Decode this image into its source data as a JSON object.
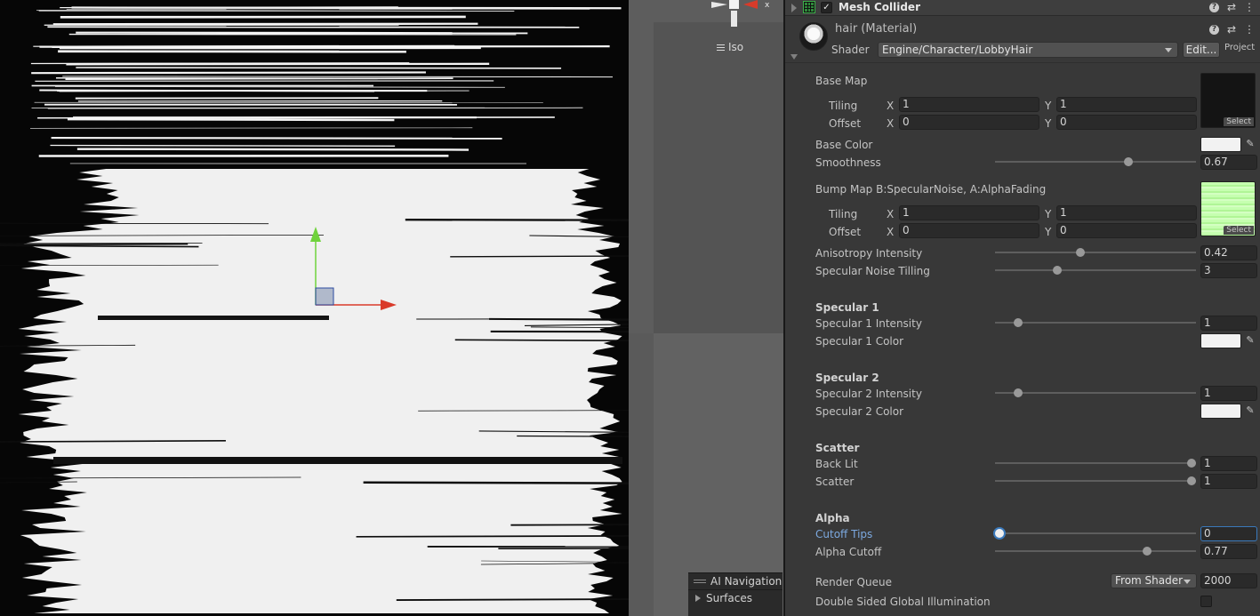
{
  "scene": {
    "iso_label": "Iso",
    "gizmo_axis_label": "x",
    "ai_navigation": {
      "title": "AI Navigation",
      "items": [
        "Surfaces"
      ]
    }
  },
  "component": {
    "title": "Mesh Collider",
    "enabled": true
  },
  "material": {
    "name": "hair (Material)",
    "shader_label": "Shader",
    "shader_value": "Engine/Character/LobbyHair",
    "edit_label": "Edit...",
    "project_label": "Project"
  },
  "props": {
    "base_map": "Base Map",
    "tiling": "Tiling",
    "offset": "Offset",
    "x": "X",
    "y": "Y",
    "base_tiling_x": "1",
    "base_tiling_y": "1",
    "base_offset_x": "0",
    "base_offset_y": "0",
    "select": "Select",
    "base_color": "Base Color",
    "smoothness": "Smoothness",
    "smoothness_val": "0.67",
    "bump_map": "Bump Map B:SpecularNoise, A:AlphaFading",
    "bump_tiling_x": "1",
    "bump_tiling_y": "1",
    "bump_offset_x": "0",
    "bump_offset_y": "0",
    "aniso": "Anisotropy Intensity",
    "aniso_val": "0.42",
    "spec_noise": "Specular Noise Tilling",
    "spec_noise_val": "3",
    "specular1": "Specular 1",
    "spec1_int": "Specular 1 Intensity",
    "spec1_int_val": "1",
    "spec1_color": "Specular 1 Color",
    "specular2": "Specular 2",
    "spec2_int": "Specular 2 Intensity",
    "spec2_int_val": "1",
    "spec2_color": "Specular 2 Color",
    "scatter_head": "Scatter",
    "back_lit": "Back Lit",
    "back_lit_val": "1",
    "scatter": "Scatter",
    "scatter_val": "1",
    "alpha": "Alpha",
    "cutoff_tips": "Cutoff Tips",
    "cutoff_tips_val": "0",
    "alpha_cutoff": "Alpha Cutoff",
    "alpha_cutoff_val": "0.77",
    "render_queue": "Render Queue",
    "render_queue_mode": "From Shader",
    "render_queue_val": "2000",
    "dsgi": "Double Sided Global Illumination"
  },
  "colors": {
    "base_color": "#f2f2f2",
    "spec1_color": "#f2f2f2",
    "spec2_color": "#f2f2f2",
    "gizmo_x": "#d93a2a",
    "gizmo_y": "#6fd23c"
  }
}
